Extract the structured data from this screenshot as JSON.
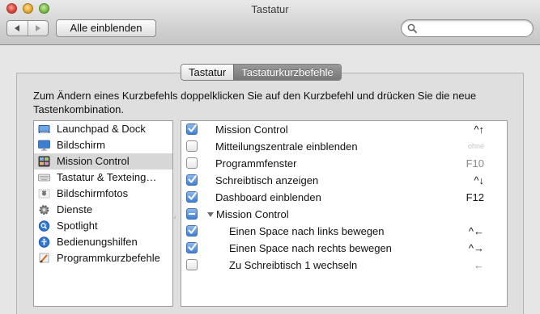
{
  "window": {
    "title": "Tastatur"
  },
  "toolbar": {
    "back_label": "◀",
    "forward_label": "▶",
    "show_all_label": "Alle einblenden",
    "search_placeholder": "",
    "search_value": ""
  },
  "tabs": [
    {
      "label": "Tastatur",
      "active": false
    },
    {
      "label": "Tastaturkurzbefehle",
      "active": true
    }
  ],
  "instruction": "Zum Ändern eines Kurzbefehls doppelklicken Sie auf den Kurzbefehl und drücken Sie die neue Tastenkombination.",
  "categories": [
    {
      "label": "Launchpad & Dock",
      "icon": "launchpad-dock-icon",
      "selected": false
    },
    {
      "label": "Bildschirm",
      "icon": "display-icon",
      "selected": false
    },
    {
      "label": "Mission Control",
      "icon": "mission-control-icon",
      "selected": true
    },
    {
      "label": "Tastatur & Texteing…",
      "icon": "keyboard-icon",
      "selected": false
    },
    {
      "label": "Bildschirmfotos",
      "icon": "screenshot-icon",
      "selected": false
    },
    {
      "label": "Dienste",
      "icon": "gear-icon",
      "selected": false
    },
    {
      "label": "Spotlight",
      "icon": "spotlight-icon",
      "selected": false
    },
    {
      "label": "Bedienungshilfen",
      "icon": "accessibility-icon",
      "selected": false
    },
    {
      "label": "Programmkurzbefehle",
      "icon": "app-shortcuts-icon",
      "selected": false
    }
  ],
  "shortcuts": [
    {
      "label": "Mission Control",
      "key": "^↑",
      "state": "on",
      "type": "item",
      "key_style": "normal"
    },
    {
      "label": "Mitteilungszentrale einblenden",
      "key": "ohne",
      "state": "off",
      "type": "item",
      "key_style": "faint"
    },
    {
      "label": "Programmfenster",
      "key": "F10",
      "state": "off",
      "type": "item",
      "key_style": "dim"
    },
    {
      "label": "Schreibtisch anzeigen",
      "key": "^↓",
      "state": "on",
      "type": "item",
      "key_style": "normal"
    },
    {
      "label": "Dashboard einblenden",
      "key": "F12",
      "state": "on",
      "type": "item",
      "key_style": "normal"
    },
    {
      "label": "Mission Control",
      "key": "",
      "state": "mixed",
      "type": "group",
      "key_style": "normal"
    },
    {
      "label": "Einen Space nach links bewegen",
      "key": "^←",
      "state": "on",
      "type": "child",
      "key_style": "normal"
    },
    {
      "label": "Einen Space nach rechts bewegen",
      "key": "^→",
      "state": "on",
      "type": "child",
      "key_style": "normal"
    },
    {
      "label": "Zu Schreibtisch 1 wechseln",
      "key": "←",
      "state": "off",
      "type": "child",
      "key_style": "dim"
    }
  ],
  "colors": {
    "checkbox_on": "#3f7fd6",
    "selection": "#d7d7d7",
    "segment_active": "#8a8a8a"
  }
}
